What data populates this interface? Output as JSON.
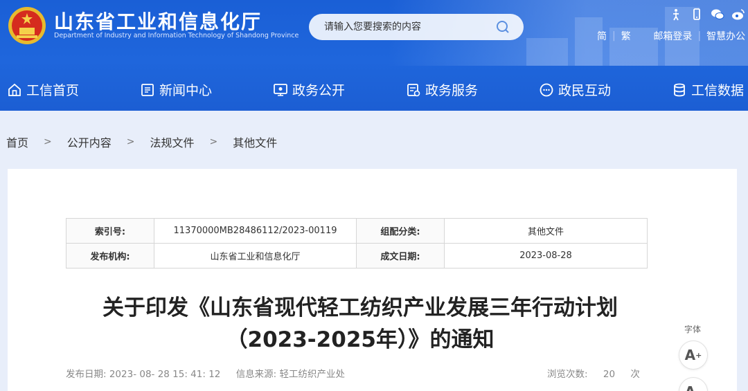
{
  "header": {
    "site_title": "山东省工业和信息化厅",
    "site_subtitle": "Department of Industry and Information Technology of Shandong Province",
    "search_placeholder": "请输入您要搜索的内容",
    "util_links": [
      "简",
      "繁",
      "邮箱登录",
      "智慧办公"
    ],
    "util_separator": "|"
  },
  "nav": {
    "items": [
      "工信首页",
      "新闻中心",
      "政务公开",
      "政务服务",
      "政民互动",
      "工信数据"
    ]
  },
  "breadcrumb": {
    "items": [
      "首页",
      "公开内容",
      "法规文件",
      "其他文件"
    ],
    "separator": ">"
  },
  "meta": {
    "index_label": "索引号:",
    "index_value": "11370000MB28486112/2023-00119",
    "category_label": "组配分类:",
    "category_value": "其他文件",
    "publisher_label": "发布机构:",
    "publisher_value": "山东省工业和信息化厅",
    "date_label": "成文日期:",
    "date_value": "2023-08-28"
  },
  "article": {
    "title_line1": "关于印发《山东省现代轻工纺织产业发展三年行动计划",
    "title_line2": "（2023-2025年）》的通知",
    "publish_date": "发布日期: 2023- 08- 28 15: 41: 12",
    "source": "信息来源: 轻工纺织产业处",
    "views_label": "浏览次数:",
    "views_count": "20",
    "views_unit": "次"
  },
  "font_tools": {
    "label": "字体",
    "increase": "A",
    "increase_mark": "+",
    "decrease": "A",
    "decrease_mark": "−"
  },
  "colors": {
    "header_blue": "#1f66dc",
    "page_bg": "#e8eefa"
  }
}
